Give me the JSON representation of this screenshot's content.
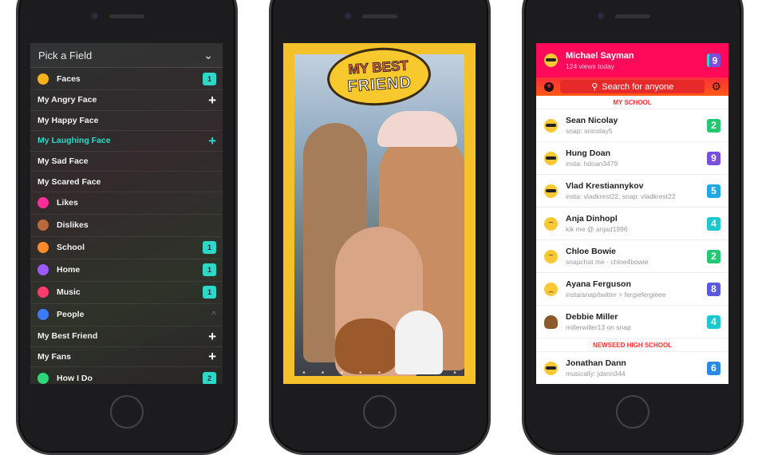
{
  "left": {
    "title": "Pick a Field",
    "items": [
      {
        "type": "cat",
        "label": "Faces",
        "icon": "face-icon",
        "color": "#f5b21a",
        "badge": "1"
      },
      {
        "type": "sub",
        "label": "My Angry Face",
        "action": "+"
      },
      {
        "type": "sub",
        "label": "My Happy Face"
      },
      {
        "type": "sub",
        "label": "My Laughing Face",
        "action": "+",
        "highlight": true
      },
      {
        "type": "sub",
        "label": "My Sad Face"
      },
      {
        "type": "sub",
        "label": "My Scared Face"
      },
      {
        "type": "cat",
        "label": "Likes",
        "icon": "heart-icon",
        "color": "#ff2d9a"
      },
      {
        "type": "cat",
        "label": "Dislikes",
        "icon": "poop-icon",
        "color": "#b86a3c"
      },
      {
        "type": "cat",
        "label": "School",
        "icon": "graduation-cap-icon",
        "color": "#ff8a2a",
        "badge": "1"
      },
      {
        "type": "cat",
        "label": "Home",
        "icon": "house-icon",
        "color": "#9b59ff",
        "badge": "1"
      },
      {
        "type": "cat",
        "label": "Music",
        "icon": "music-note-icon",
        "color": "#ff3b6b",
        "badge": "1"
      },
      {
        "type": "cat",
        "label": "People",
        "icon": "people-icon",
        "color": "#3b7bff",
        "expanded": "^"
      },
      {
        "type": "sub",
        "label": "My Best Friend",
        "action": "+"
      },
      {
        "type": "sub",
        "label": "My Fans",
        "action": "+"
      },
      {
        "type": "cat",
        "label": "How I Do",
        "icon": "running-icon",
        "color": "#2ed87a",
        "badge": "2"
      }
    ]
  },
  "middle": {
    "sticker_top": "MY BEST",
    "sticker_bottom": "FRIEND",
    "toolbar_icons": [
      "face-icon",
      "heart-icon",
      "poop-icon",
      "graduation-cap-icon",
      "house-icon",
      "music-note-icon",
      "running-icon",
      "people-icon",
      "fork-icon"
    ]
  },
  "right": {
    "user": {
      "name": "Michael Sayman",
      "views": "124 views today",
      "badge": "9"
    },
    "search_placeholder": "Search for anyone",
    "sections": [
      {
        "label": "MY SCHOOL",
        "people": [
          {
            "name": "Sean Nicolay",
            "sub": "snap: snicolay5",
            "emoji": "cool",
            "badge": "2",
            "color": "#22c872"
          },
          {
            "name": "Hung Doan",
            "sub": "insta: hdoan3479",
            "emoji": "cool",
            "badge": "9",
            "color": "#7a4fe0"
          },
          {
            "name": "Vlad Krestiannykov",
            "sub": "insta: vladkrest22, snap: vladkrest22",
            "emoji": "cool",
            "badge": "5",
            "color": "#1ea8e8"
          },
          {
            "name": "Anja Dinhopl",
            "sub": "kik me @ anjad1996",
            "emoji": "meh",
            "badge": "4",
            "color": "#1ec8d0"
          },
          {
            "name": "Chloe Bowie",
            "sub": "snapchat me - chloe4bowie",
            "emoji": "meh",
            "badge": "2",
            "color": "#22c872"
          },
          {
            "name": "Ayana Ferguson",
            "sub": "insta/snap/twitter > fergiefergieee",
            "emoji": "sad",
            "badge": "8",
            "color": "#5a5ae0"
          },
          {
            "name": "Debbie Miller",
            "sub": "millerwiller13 on snap",
            "emoji": "poo",
            "badge": "4",
            "color": "#1ec8d0"
          }
        ]
      },
      {
        "label": "NEWSEED HIGH SCHOOL",
        "people": [
          {
            "name": "Jonathan Dann",
            "sub": "musically: jdann344",
            "emoji": "cool",
            "badge": "6",
            "color": "#2a8ae8"
          }
        ]
      }
    ]
  }
}
